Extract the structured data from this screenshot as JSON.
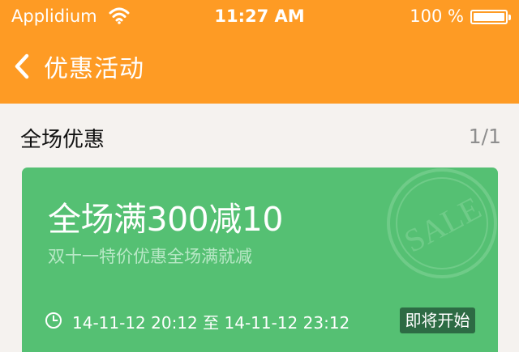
{
  "status_bar": {
    "carrier": "Applidium",
    "time": "11:27 AM",
    "battery": "100 %"
  },
  "nav": {
    "title": "优惠活动",
    "back_icon": "chevron-left-icon"
  },
  "section": {
    "title": "全场优惠",
    "count": "1/1"
  },
  "promotions": [
    {
      "title": "全场满300减10",
      "subtitle": "双十一特价优惠全场满就减",
      "time_range": "14-11-12 20:12 至 14-11-12 23:12",
      "status": "即将开始",
      "stamp_text": "SALE"
    }
  ],
  "colors": {
    "header": "#fe9b24",
    "card": "#55c073",
    "badge": "#2d6b44",
    "background": "#f5f2ef"
  }
}
